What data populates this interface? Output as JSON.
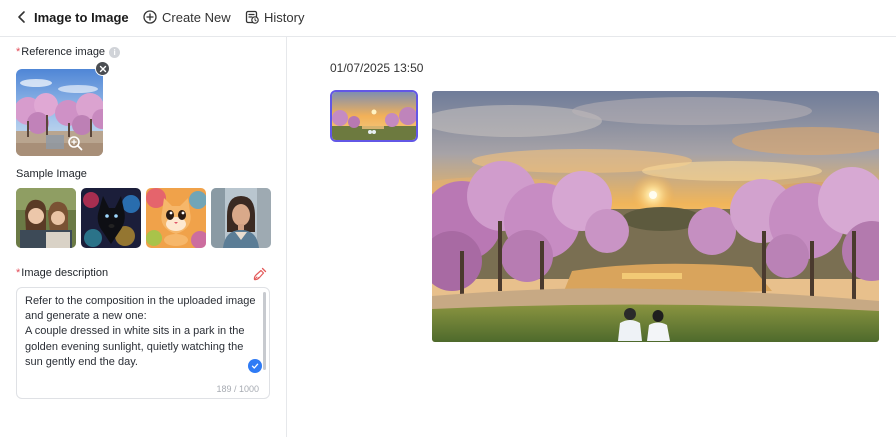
{
  "header": {
    "back_icon": "chevron-left-icon",
    "title": "Image to Image",
    "create_icon": "plus-circle-icon",
    "create_label": "Create New",
    "history_icon": "history-icon",
    "history_label": "History"
  },
  "left": {
    "reference": {
      "required_mark": "*",
      "label": "Reference image",
      "info_icon": "info-icon",
      "close_icon": "close-icon",
      "zoom_icon": "zoom-in-icon"
    },
    "samples": {
      "label": "Sample Image",
      "items": [
        "sample-friends-selfie",
        "sample-black-dog-galaxy",
        "sample-cartoon-cat",
        "sample-portrait-woman"
      ]
    },
    "description": {
      "required_mark": "*",
      "label": "Image description",
      "clear_icon": "broom-icon",
      "text": "Refer to the composition in the uploaded image and generate a new one:\nA couple dressed in white sits in a park in the golden evening sunlight, quietly watching the sun gently end the day.",
      "count": "189 / 1000",
      "confirm_icon": "check-circle-icon"
    }
  },
  "right": {
    "timestamp": "01/07/2025 13:50"
  },
  "colors": {
    "accent": "#6257e6",
    "required": "#e34d59",
    "check": "#2f7bf5",
    "blossom": "#c98fc4",
    "sunset": "#f2a03a"
  }
}
